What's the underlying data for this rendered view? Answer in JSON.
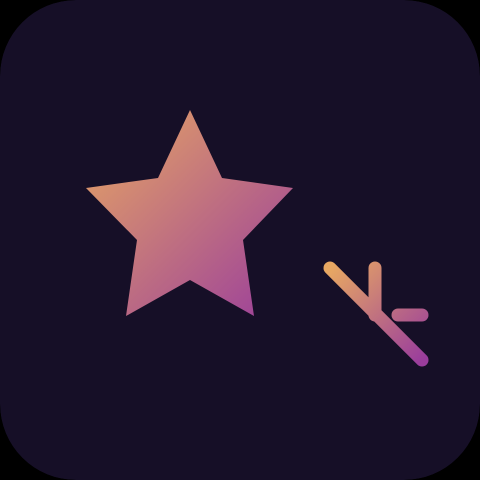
{
  "app_icon": {
    "background_color": "#160F27",
    "gradient": {
      "start": "#E8A862",
      "end": "#9A3D9C"
    },
    "star_icon": "star-icon",
    "pin_icon": "pushpin-icon"
  }
}
